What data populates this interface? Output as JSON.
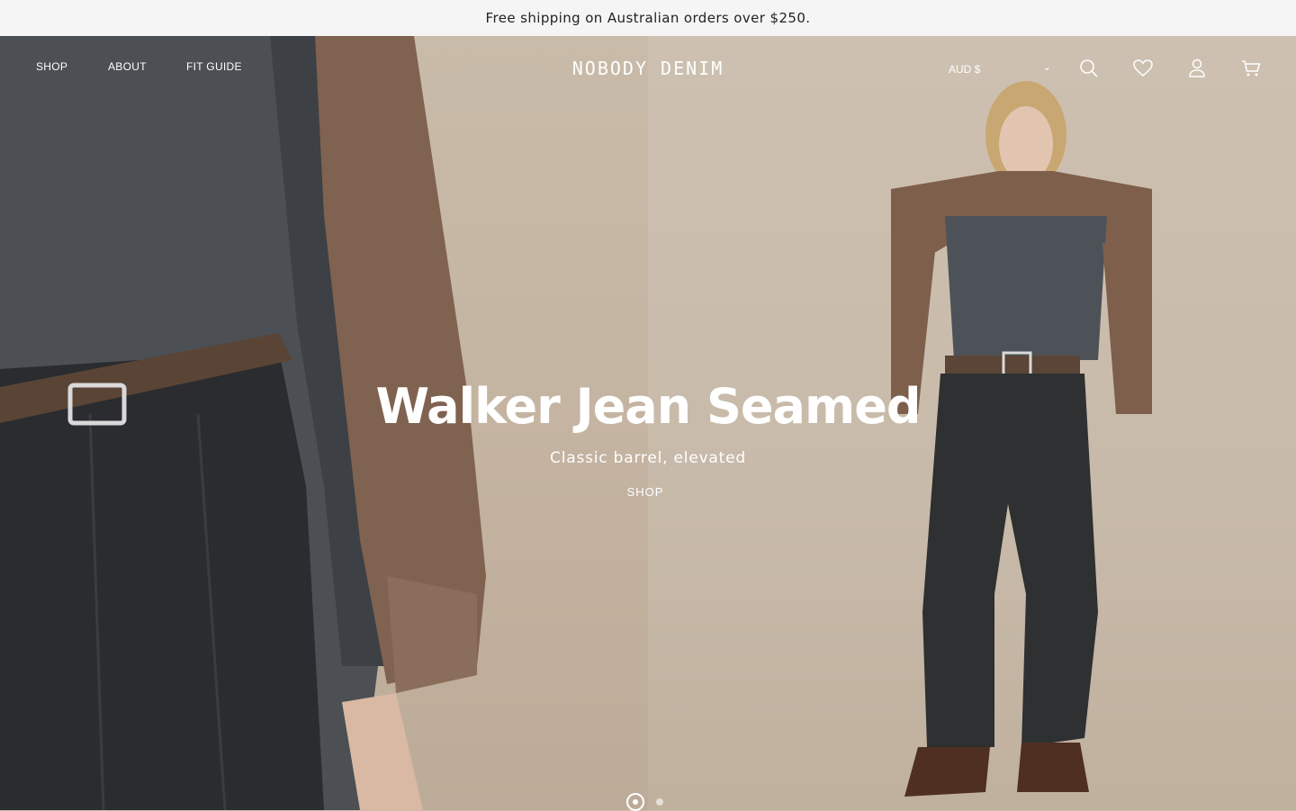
{
  "announcement": {
    "text": "Free shipping on Australian orders over $250."
  },
  "nav": {
    "links": [
      "SHOP",
      "ABOUT",
      "FIT GUIDE"
    ],
    "logo": "NOBODY DENIM",
    "currency": "AUD $",
    "icons": [
      "search-icon",
      "heart-icon",
      "account-icon",
      "cart-icon"
    ]
  },
  "hero": {
    "title": "Walker Jean Seamed",
    "subtitle": "Classic barrel, elevated",
    "cta": "SHOP",
    "slides": {
      "current": 1,
      "total": 2
    }
  },
  "colors": {
    "background": "#cbbdad",
    "text_on_hero": "#ffffff",
    "announcement_bg": "#f5f5f5"
  }
}
